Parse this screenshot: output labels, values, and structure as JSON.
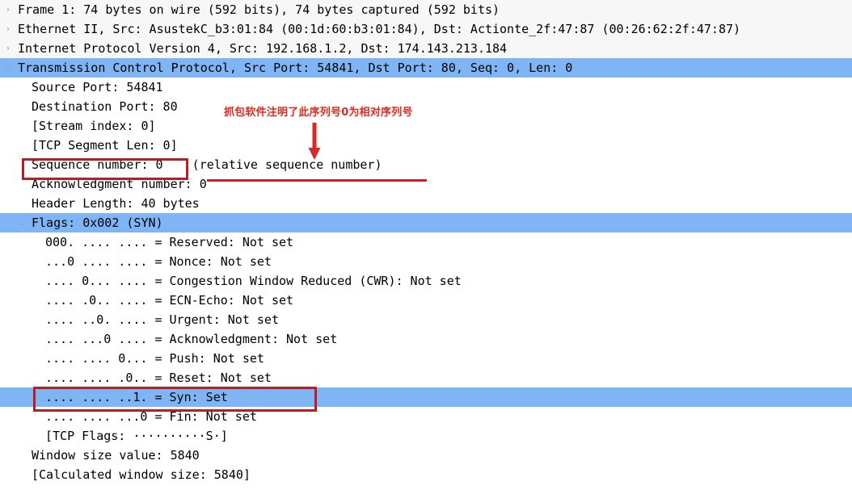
{
  "pane": {
    "name": "packet-details",
    "highlight_color": "#7fb5f5",
    "alt_row_color": "#f7f7f7",
    "annotation_color": "#dd2b20",
    "annotation_box_color": "#b52025"
  },
  "rows": [
    {
      "id": "frame",
      "text": "Frame 1: 74 bytes on wire (592 bits), 74 bytes captured (592 bits)",
      "chevron": "collapsed",
      "indent": 0,
      "selected": false,
      "alt_bg": true
    },
    {
      "id": "ethernet",
      "text": "Ethernet II, Src: AsustekC_b3:01:84 (00:1d:60:b3:01:84), Dst: Actionte_2f:47:87 (00:26:62:2f:47:87)",
      "chevron": "collapsed",
      "indent": 0,
      "selected": false,
      "alt_bg": true
    },
    {
      "id": "ipv4",
      "text": "Internet Protocol Version 4, Src: 192.168.1.2, Dst: 174.143.213.184",
      "chevron": "collapsed",
      "indent": 0,
      "selected": false,
      "alt_bg": true
    },
    {
      "id": "tcp",
      "text": "Transmission Control Protocol, Src Port: 54841, Dst Port: 80, Seq: 0, Len: 0",
      "chevron": "expanded",
      "indent": 0,
      "selected": true,
      "alt_bg": false
    },
    {
      "id": "source-port",
      "text": "Source Port: 54841",
      "chevron": "none",
      "indent": 1,
      "selected": false,
      "alt_bg": false
    },
    {
      "id": "destination-port",
      "text": "Destination Port: 80",
      "chevron": "none",
      "indent": 1,
      "selected": false,
      "alt_bg": false
    },
    {
      "id": "stream-index",
      "text": "[Stream index: 0]",
      "chevron": "none",
      "indent": 1,
      "selected": false,
      "alt_bg": false
    },
    {
      "id": "tcp-segment-len",
      "text": "[TCP Segment Len: 0]",
      "chevron": "none",
      "indent": 1,
      "selected": false,
      "alt_bg": false
    },
    {
      "id": "sequence-number",
      "text": "Sequence number: 0    (relative sequence number)",
      "chevron": "none",
      "indent": 1,
      "selected": false,
      "alt_bg": false
    },
    {
      "id": "acknowledgment-number",
      "text": "Acknowledgment number: 0",
      "chevron": "none",
      "indent": 1,
      "selected": false,
      "alt_bg": false
    },
    {
      "id": "header-length",
      "text": "Header Length: 40 bytes",
      "chevron": "none",
      "indent": 1,
      "selected": false,
      "alt_bg": false
    },
    {
      "id": "flags",
      "text": "Flags: 0x002 (SYN)",
      "chevron": "expanded",
      "indent": 1,
      "selected": true,
      "alt_bg": false
    },
    {
      "id": "flag-reserved",
      "text": "000. .... .... = Reserved: Not set",
      "chevron": "none",
      "indent": 2,
      "selected": false,
      "alt_bg": false
    },
    {
      "id": "flag-nonce",
      "text": "...0 .... .... = Nonce: Not set",
      "chevron": "none",
      "indent": 2,
      "selected": false,
      "alt_bg": false
    },
    {
      "id": "flag-cwr",
      "text": ".... 0... .... = Congestion Window Reduced (CWR): Not set",
      "chevron": "none",
      "indent": 2,
      "selected": false,
      "alt_bg": false
    },
    {
      "id": "flag-ecn-echo",
      "text": ".... .0.. .... = ECN-Echo: Not set",
      "chevron": "none",
      "indent": 2,
      "selected": false,
      "alt_bg": false
    },
    {
      "id": "flag-urgent",
      "text": ".... ..0. .... = Urgent: Not set",
      "chevron": "none",
      "indent": 2,
      "selected": false,
      "alt_bg": false
    },
    {
      "id": "flag-acknowledgment",
      "text": ".... ...0 .... = Acknowledgment: Not set",
      "chevron": "none",
      "indent": 2,
      "selected": false,
      "alt_bg": false
    },
    {
      "id": "flag-push",
      "text": ".... .... 0... = Push: Not set",
      "chevron": "none",
      "indent": 2,
      "selected": false,
      "alt_bg": false
    },
    {
      "id": "flag-reset",
      "text": ".... .... .0.. = Reset: Not set",
      "chevron": "none",
      "indent": 2,
      "selected": false,
      "alt_bg": false
    },
    {
      "id": "flag-syn",
      "text": ".... .... ..1. = Syn: Set",
      "chevron": "collapsed",
      "indent": 2,
      "selected": true,
      "alt_bg": false
    },
    {
      "id": "flag-fin",
      "text": ".... .... ...0 = Fin: Not set",
      "chevron": "none",
      "indent": 2,
      "selected": false,
      "alt_bg": false
    },
    {
      "id": "tcp-flags-summary",
      "text": "[TCP Flags: ··········S·]",
      "chevron": "none",
      "indent": 2,
      "selected": false,
      "alt_bg": false
    },
    {
      "id": "window-size-value",
      "text": "Window size value: 5840",
      "chevron": "none",
      "indent": 1,
      "selected": false,
      "alt_bg": false
    },
    {
      "id": "calculated-window-size",
      "text": "[Calculated window size: 5840]",
      "chevron": "none",
      "indent": 1,
      "selected": false,
      "alt_bg": false
    }
  ],
  "annotations": {
    "note_text": "抓包软件注明了此序列号0为相对序列号",
    "note_translation_hint": "relative sequence number note"
  },
  "chevron_glyphs": {
    "collapsed": "›",
    "expanded": "⌄"
  }
}
